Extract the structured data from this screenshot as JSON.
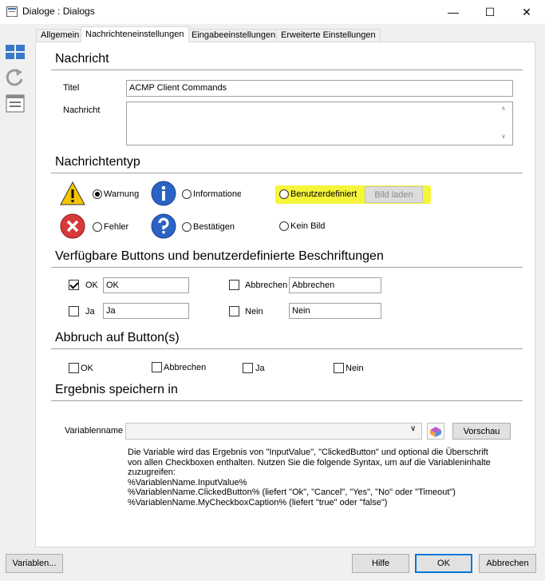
{
  "window": {
    "title": "Dialoge : Dialogs",
    "minimize": "—",
    "maximize": "☐",
    "close": "✕"
  },
  "tabs": [
    {
      "label": "Allgemein"
    },
    {
      "label": "Nachrichteneinstellungen"
    },
    {
      "label": "Eingabeeinstellungen"
    },
    {
      "label": "Erweiterte Einstellungen"
    }
  ],
  "toolbar_icons": [
    "layout-icon",
    "refresh-icon",
    "form-icon"
  ],
  "nachricht": {
    "heading": "Nachricht",
    "titel_label": "Titel",
    "titel_value": "ACMP Client Commands",
    "nachricht_label": "Nachricht",
    "nachricht_value": ""
  },
  "nachrichtentyp": {
    "heading": "Nachrichtentyp",
    "options": {
      "warnung": "Warnung",
      "informationen": "Informatione",
      "benutzerdefiniert": "Benutzerdefiniert",
      "fehler": "Fehler",
      "bestaetigen": "Bestätigen",
      "kein_bild": "Kein Bild"
    },
    "selected": "Warnung",
    "bild_laden": "Bild laden",
    "highlight_color": "#f5f53a"
  },
  "buttons_section": {
    "heading": "Verfügbare Buttons und benutzerdefinierte Beschriftungen",
    "ok_label": "OK",
    "ok_value": "OK",
    "ok_checked": true,
    "abbrechen_label": "Abbrechen",
    "abbrechen_value": "Abbrechen",
    "abbrechen_checked": false,
    "ja_label": "Ja",
    "ja_value": "Ja",
    "ja_checked": false,
    "nein_label": "Nein",
    "nein_value": "Nein",
    "nein_checked": false
  },
  "abbruch": {
    "heading": "Abbruch auf Button(s)",
    "ok": "OK",
    "abbrechen": "Abbrechen",
    "ja": "Ja",
    "nein": "Nein"
  },
  "ergebnis": {
    "heading": "Ergebnis speichern in",
    "variablenname_label": "Variablenname",
    "variablenname_value": "",
    "vorschau": "Vorschau",
    "info_lines": [
      "Die Variable wird das Ergebnis von \"InputValue\", \"ClickedButton\" und optional die Überschrift",
      "von allen Checkboxen enthalten. Nutzen Sie die folgende Syntax, um auf die Variableninhalte",
      "zuzugreifen:",
      "%VariablenName.InputValue%",
      "%VariablenName.ClickedButton% (liefert \"Ok\", \"Cancel\", \"Yes\", \"No\" oder \"Timeout\")",
      "%VariablenName.MyCheckboxCaption% (liefert \"true\" oder \"false\")"
    ]
  },
  "footer": {
    "variablen": "Variablen...",
    "hilfe": "Hilfe",
    "ok": "OK",
    "abbrechen": "Abbrechen"
  }
}
